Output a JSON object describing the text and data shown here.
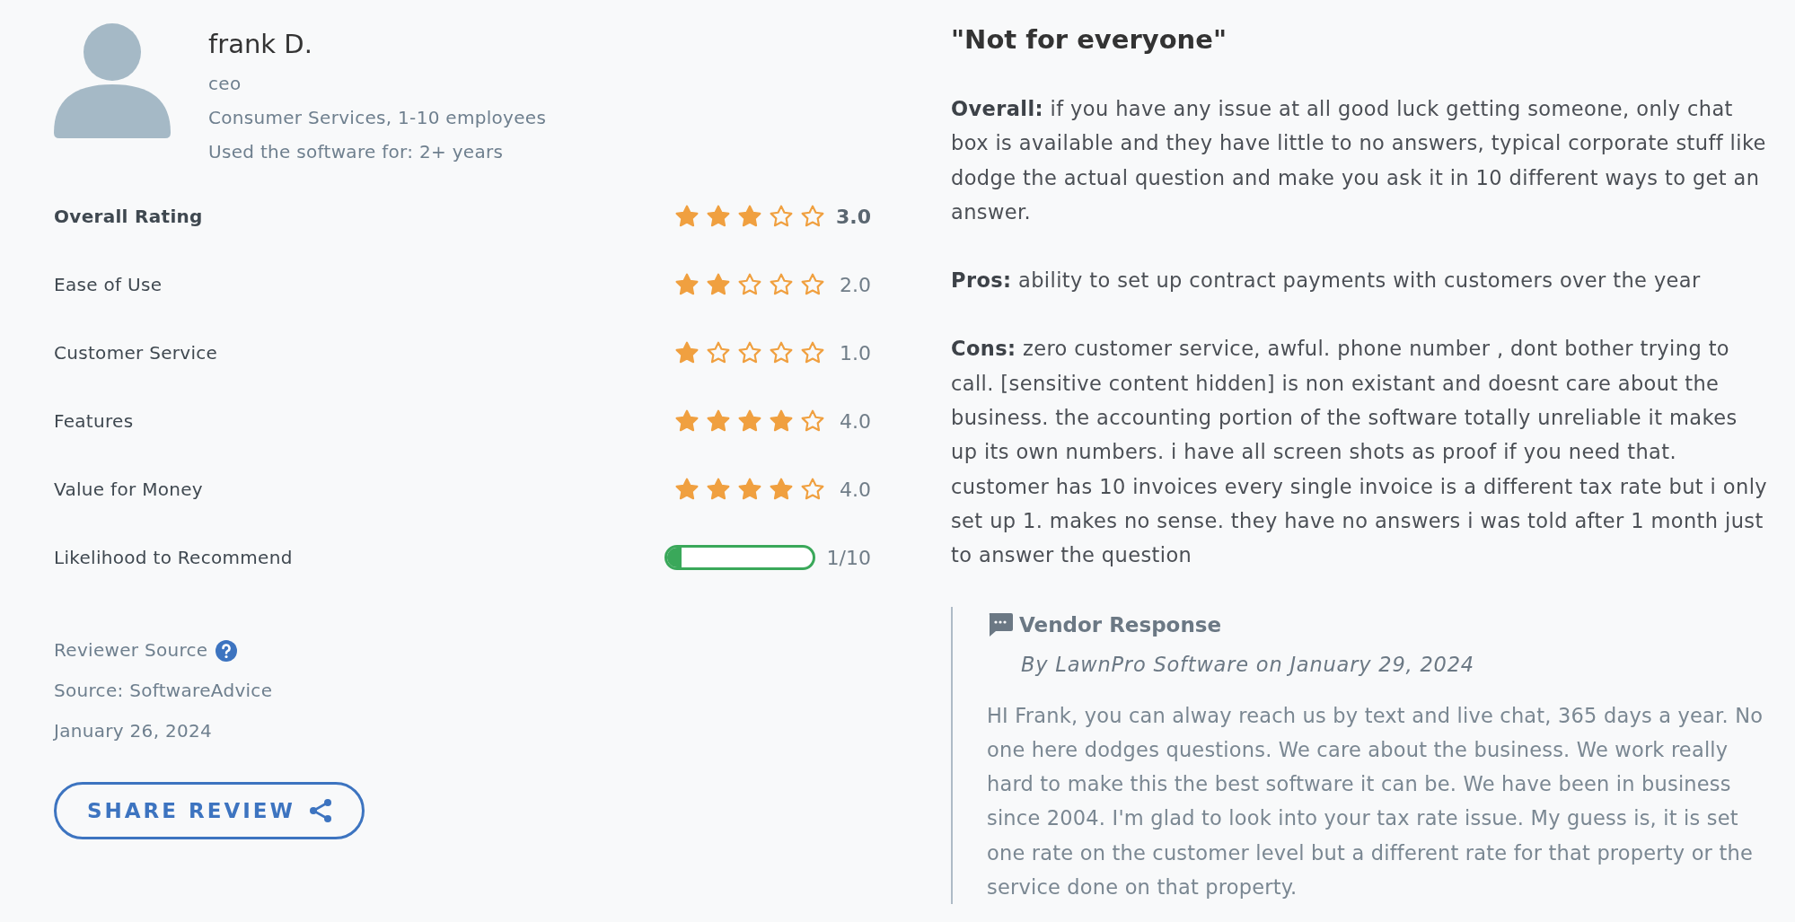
{
  "reviewer": {
    "name": "frank D.",
    "role": "ceo",
    "industry": "Consumer Services, 1-10 employees",
    "usage": "Used the software for: 2+ years"
  },
  "ratings": [
    {
      "kind": "stars",
      "label": "Overall Rating",
      "stars": 3,
      "reading": "3.0",
      "bold": true
    },
    {
      "kind": "stars",
      "label": "Ease of Use",
      "stars": 2,
      "reading": "2.0",
      "bold": false
    },
    {
      "kind": "stars",
      "label": "Customer Service",
      "stars": 1,
      "reading": "1.0",
      "bold": false
    },
    {
      "kind": "stars",
      "label": "Features",
      "stars": 4,
      "reading": "4.0",
      "bold": false
    },
    {
      "kind": "stars",
      "label": "Value for Money",
      "stars": 4,
      "reading": "4.0",
      "bold": false
    },
    {
      "kind": "meter",
      "label": "Likelihood to Recommend",
      "level": 0.1,
      "reading": "1/10",
      "bold": false
    }
  ],
  "source": {
    "label": "Reviewer Source",
    "value": "Source: SoftwareAdvice",
    "date": "January 26, 2024"
  },
  "share_button": "SHARE REVIEW",
  "review": {
    "title": "\"Not for everyone\"",
    "sections": [
      "**Overall:** if you have any issue at all good luck getting someone, only chat box is available and they have little to no answers, typical corporate stuff like dodge the actual question and make you ask it in 10 different ways to get an answer.",
      "**Pros:** ability to set up contract payments with customers over the year",
      "**Cons:** zero customer service, awful. phone number , dont bother trying to call. [sensitive content hidden] is non existant and doesnt care about the business. the accounting portion of the software totally unreliable it makes up its own numbers. i have all screen shots as proof if you need that. customer has 10 invoices every single invoice is a different tax rate but i only set up 1. makes no sense. they have no answers i was told after 1 month just to answer the question"
    ]
  },
  "vendor_response": {
    "heading": "Vendor Response",
    "byline": "By LawnPro Software on January 29, 2024",
    "text": "HI Frank, you can alway reach us by text and live chat, 365 days a year. No one here dodges questions. We care about the business. We work really hard to make this the best software it can be. We have been in business since 2004. I'm glad to look into your tax rate issue. My guess is, it is set one rate on the customer level but a different rate for that property or the service done on that property."
  }
}
